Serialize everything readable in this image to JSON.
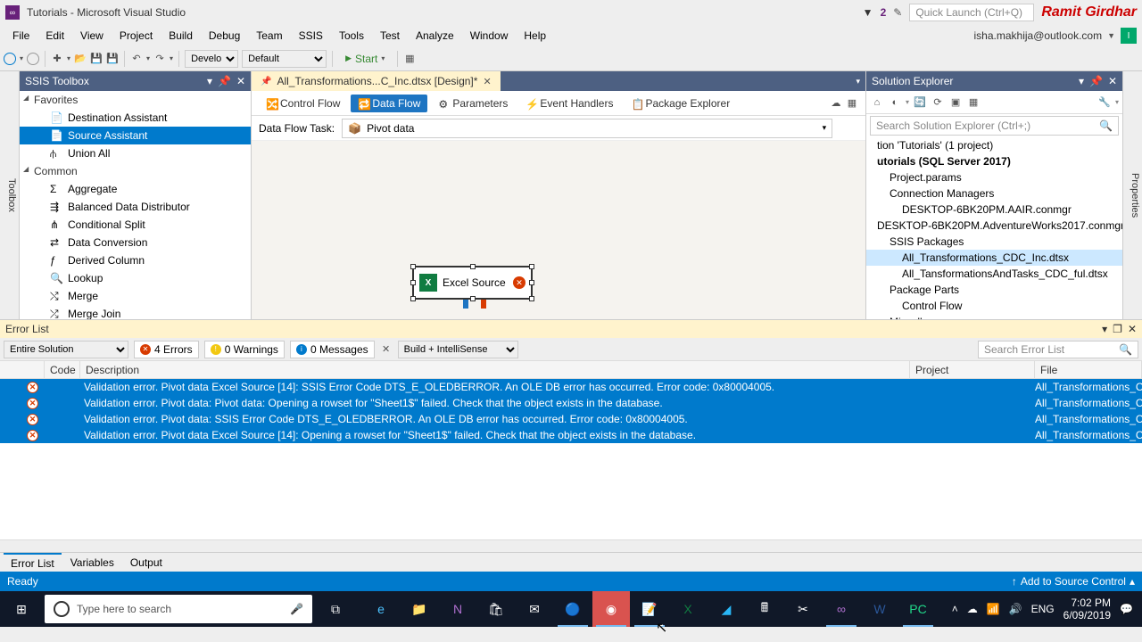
{
  "titlebar": {
    "title": "Tutorials - Microsoft Visual Studio",
    "notif_badge": "2",
    "quick_placeholder": "Quick Launch (Ctrl+Q)",
    "watermark": "Ramit Girdhar"
  },
  "menubar": {
    "items": [
      "File",
      "Edit",
      "View",
      "Project",
      "Build",
      "Debug",
      "Team",
      "SSIS",
      "Tools",
      "Test",
      "Analyze",
      "Window",
      "Help"
    ],
    "user": "isha.makhija@outlook.com",
    "avatar": "I"
  },
  "toolbar": {
    "config": "Develop",
    "platform": "Default",
    "start": "Start"
  },
  "toolbox": {
    "title": "SSIS Toolbox",
    "cats": [
      "Favorites",
      "Common"
    ],
    "fav_items": [
      "Destination Assistant",
      "Source Assistant",
      "Union All"
    ],
    "common_items": [
      "Aggregate",
      "Balanced Data Distributor",
      "Conditional Split",
      "Data Conversion",
      "Derived Column",
      "Lookup",
      "Merge",
      "Merge Join"
    ],
    "selected": "Source Assistant"
  },
  "designer": {
    "tab": "All_Transformations...C_Inc.dtsx [Design]*",
    "sub_tabs": [
      "Control Flow",
      "Data Flow",
      "Parameters",
      "Event Handlers",
      "Package Explorer"
    ],
    "active_sub": "Data Flow",
    "dft_label": "Data Flow Task:",
    "dft_value": "Pivot data",
    "shape_label": "Excel Source"
  },
  "solution": {
    "title": "Solution Explorer",
    "search_placeholder": "Search Solution Explorer (Ctrl+;)",
    "nodes": [
      {
        "t": "tion 'Tutorials' (1 project)",
        "d": 0,
        "b": false
      },
      {
        "t": "utorials (SQL Server 2017)",
        "d": 0,
        "b": true
      },
      {
        "t": "Project.params",
        "d": 1,
        "b": false
      },
      {
        "t": "Connection Managers",
        "d": 1,
        "b": false
      },
      {
        "t": "DESKTOP-6BK20PM.AAIR.conmgr",
        "d": 2,
        "b": false
      },
      {
        "t": "DESKTOP-6BK20PM.AdventureWorks2017.conmgr",
        "d": 2,
        "b": false
      },
      {
        "t": "SSIS Packages",
        "d": 1,
        "b": false
      },
      {
        "t": "All_Transformations_CDC_Inc.dtsx",
        "d": 2,
        "b": false,
        "sel": true
      },
      {
        "t": "All_TansformationsAndTasks_CDC_ful.dtsx",
        "d": 2,
        "b": false
      },
      {
        "t": "Package Parts",
        "d": 1,
        "b": false
      },
      {
        "t": "Control Flow",
        "d": 2,
        "b": false
      },
      {
        "t": "Miscellaneous",
        "d": 1,
        "b": false
      }
    ]
  },
  "errorlist": {
    "title": "Error List",
    "scope": "Entire Solution",
    "filters": {
      "errors": "4 Errors",
      "warnings": "0 Warnings",
      "messages": "0 Messages"
    },
    "build_combo": "Build + IntelliSense",
    "search_placeholder": "Search Error List",
    "cols": {
      "code": "Code",
      "desc": "Description",
      "proj": "Project",
      "file": "File"
    },
    "rows": [
      {
        "desc": "Validation error. Pivot data Excel Source [14]: SSIS Error Code DTS_E_OLEDBERROR.  An OLE DB error has occurred. Error code: 0x80004005.",
        "file": "All_Transformations_CDC"
      },
      {
        "desc": "Validation error. Pivot data: Pivot data: Opening a rowset for \"Sheet1$\" failed. Check that the object exists in the database.",
        "file": "All_Transformations_CDC"
      },
      {
        "desc": "Validation error. Pivot data: SSIS Error Code DTS_E_OLEDBERROR.  An OLE DB error has occurred. Error code: 0x80004005.",
        "file": "All_Transformations_CDC"
      },
      {
        "desc": "Validation error. Pivot data Excel Source [14]: Opening a rowset for \"Sheet1$\" failed. Check that the object exists in the database.",
        "file": "All_Transformations_CDC"
      }
    ]
  },
  "bottom_tabs": [
    "Error List",
    "Variables",
    "Output"
  ],
  "statusbar": {
    "left": "Ready",
    "right": "Add to Source Control"
  },
  "side_tabs": {
    "left": "Toolbox",
    "right": "Properties"
  },
  "taskbar": {
    "search_placeholder": "Type here to search",
    "tray": {
      "lang": "ENG",
      "time": "7:02 PM",
      "date": "6/09/2019"
    }
  }
}
